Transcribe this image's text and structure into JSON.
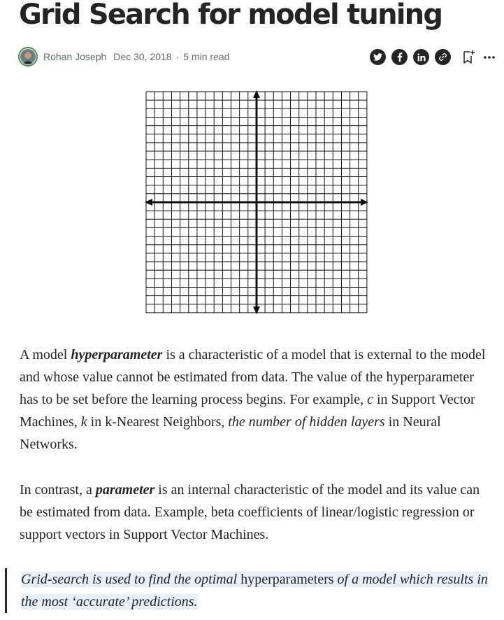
{
  "article": {
    "title": "Grid Search for model tuning",
    "author": "Rohan Joseph",
    "date": "Dec 30, 2018",
    "separator": "·",
    "read_time": "5 min read"
  },
  "share": {
    "icons": [
      "twitter-icon",
      "facebook-icon",
      "linkedin-icon",
      "link-icon",
      "bookmark-icon",
      "more-icon"
    ]
  },
  "body": {
    "p1": {
      "t1": "A model ",
      "t2": "hyperparameter",
      "t3": " is a characteristic of a model that is external to the model and whose value cannot be estimated from data. The value of the hyperparameter has to be set before the learning process begins. For example, ",
      "t4": "c",
      "t5": " in Support Vector Machines, ",
      "t6": "k",
      "t7": " in k-Nearest Neighbors, ",
      "t8": "the number of hidden layers",
      "t9": " in Neural Networks."
    },
    "p2": {
      "t1": "In contrast, a ",
      "t2": "parameter",
      "t3": " is an internal characteristic of the model and its value can be estimated from data. Example, beta coefficients of linear/logistic regression or support vectors in Support Vector Machines."
    },
    "quote": {
      "t1": "Grid-search is used to find the optimal ",
      "t2": "hyperparameters",
      "t3": " of a model which results in the most ‘accurate’ predictions."
    }
  },
  "colors": {
    "text": "#242424",
    "author": "#5a6f6a",
    "meta": "#6b6b6b",
    "highlight": "#e8f0fb",
    "avatar_ring": "#4a8c4a"
  }
}
